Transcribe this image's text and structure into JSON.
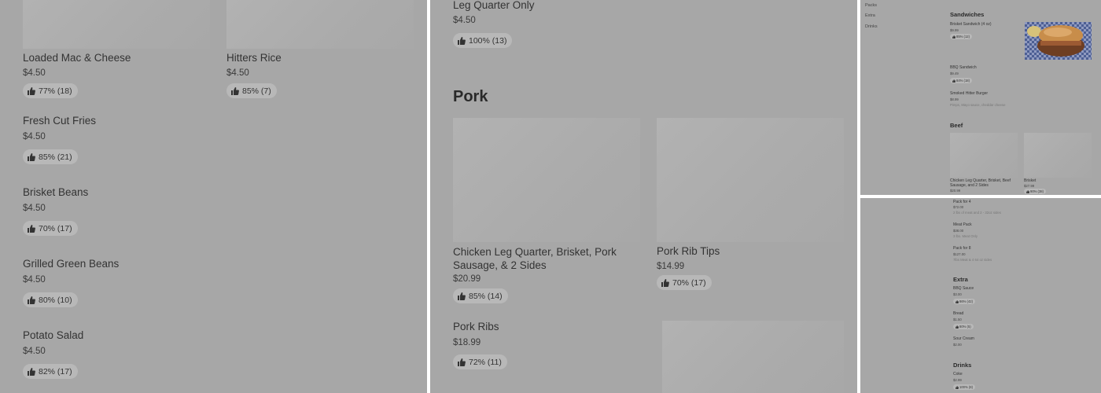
{
  "panel1": {
    "items": [
      {
        "name": "Loaded Mac & Cheese",
        "price": "$4.50",
        "rating": "77% (18)"
      },
      {
        "name": "Hitters Rice",
        "price": "$4.50",
        "rating": "85% (7)"
      },
      {
        "name": "Fresh Cut Fries",
        "price": "$4.50",
        "rating": "85% (21)"
      },
      {
        "name": "Brisket Beans",
        "price": "$4.50",
        "rating": "70% (17)"
      },
      {
        "name": "Grilled Green Beans",
        "price": "$4.50",
        "rating": "80% (10)"
      },
      {
        "name": "Potato Salad",
        "price": "$4.50",
        "rating": "82% (17)"
      }
    ]
  },
  "panel2": {
    "top_item": {
      "name": "Leg Quarter Only",
      "price": "$4.50",
      "rating": "100% (13)"
    },
    "section_title": "Pork",
    "items": [
      {
        "name": "Chicken Leg Quarter, Brisket, Pork Sausage, & 2 Sides",
        "price": "$20.99",
        "rating": "85% (14)"
      },
      {
        "name": "Pork Rib Tips",
        "price": "$14.99",
        "rating": "70% (17)"
      },
      {
        "name": "Pork Ribs",
        "price": "$18.99",
        "rating": "72% (11)"
      }
    ]
  },
  "panel3": {
    "nav": [
      "Packs",
      "Extra",
      "Drinks"
    ],
    "sandwiches": {
      "title": "Sandwiches",
      "items": [
        {
          "name": "Brisket Sandwich (4 oz)",
          "price": "$9.99",
          "rating": "85% (12)"
        },
        {
          "name": "BBQ Sandwich",
          "price": "$9.49",
          "rating": "84% (18)"
        },
        {
          "name": "Smoked Hitter Burger",
          "price": "$8.99",
          "desc": "Pimps, Mayo sauce, cheddar cheese"
        }
      ]
    },
    "beef": {
      "title": "Beef",
      "items": [
        {
          "name": "Chicken Leg Quarter, Brisket, Beef Sausage, and 2 Sides",
          "price": "$20.99"
        },
        {
          "name": "Brisket",
          "price": "$27.99",
          "rating": "90% (38)"
        }
      ]
    }
  },
  "panel4": {
    "packs": [
      {
        "name": "Pack for 4",
        "price": "$72.00",
        "desc": "2 lbs of meat and 2 - 32oz sides"
      },
      {
        "name": "Meat Pack",
        "price": "$38.00",
        "desc": "3 lbs. Meat Only"
      },
      {
        "name": "Pack for 8",
        "price": "$127.00",
        "desc": "7lbs Meat & 4 64 oz sides"
      }
    ],
    "extra": {
      "title": "Extra",
      "items": [
        {
          "name": "BBQ Sauce",
          "price": "$3.00",
          "rating": "86% (42)"
        },
        {
          "name": "Bread",
          "price": "$1.50",
          "rating": "80% (5)"
        },
        {
          "name": "Sour Cream",
          "price": "$2.00"
        }
      ]
    },
    "drinks": {
      "title": "Drinks",
      "items": [
        {
          "name": "Coke",
          "price": "$2.99",
          "rating": "100% (8)"
        }
      ]
    }
  }
}
